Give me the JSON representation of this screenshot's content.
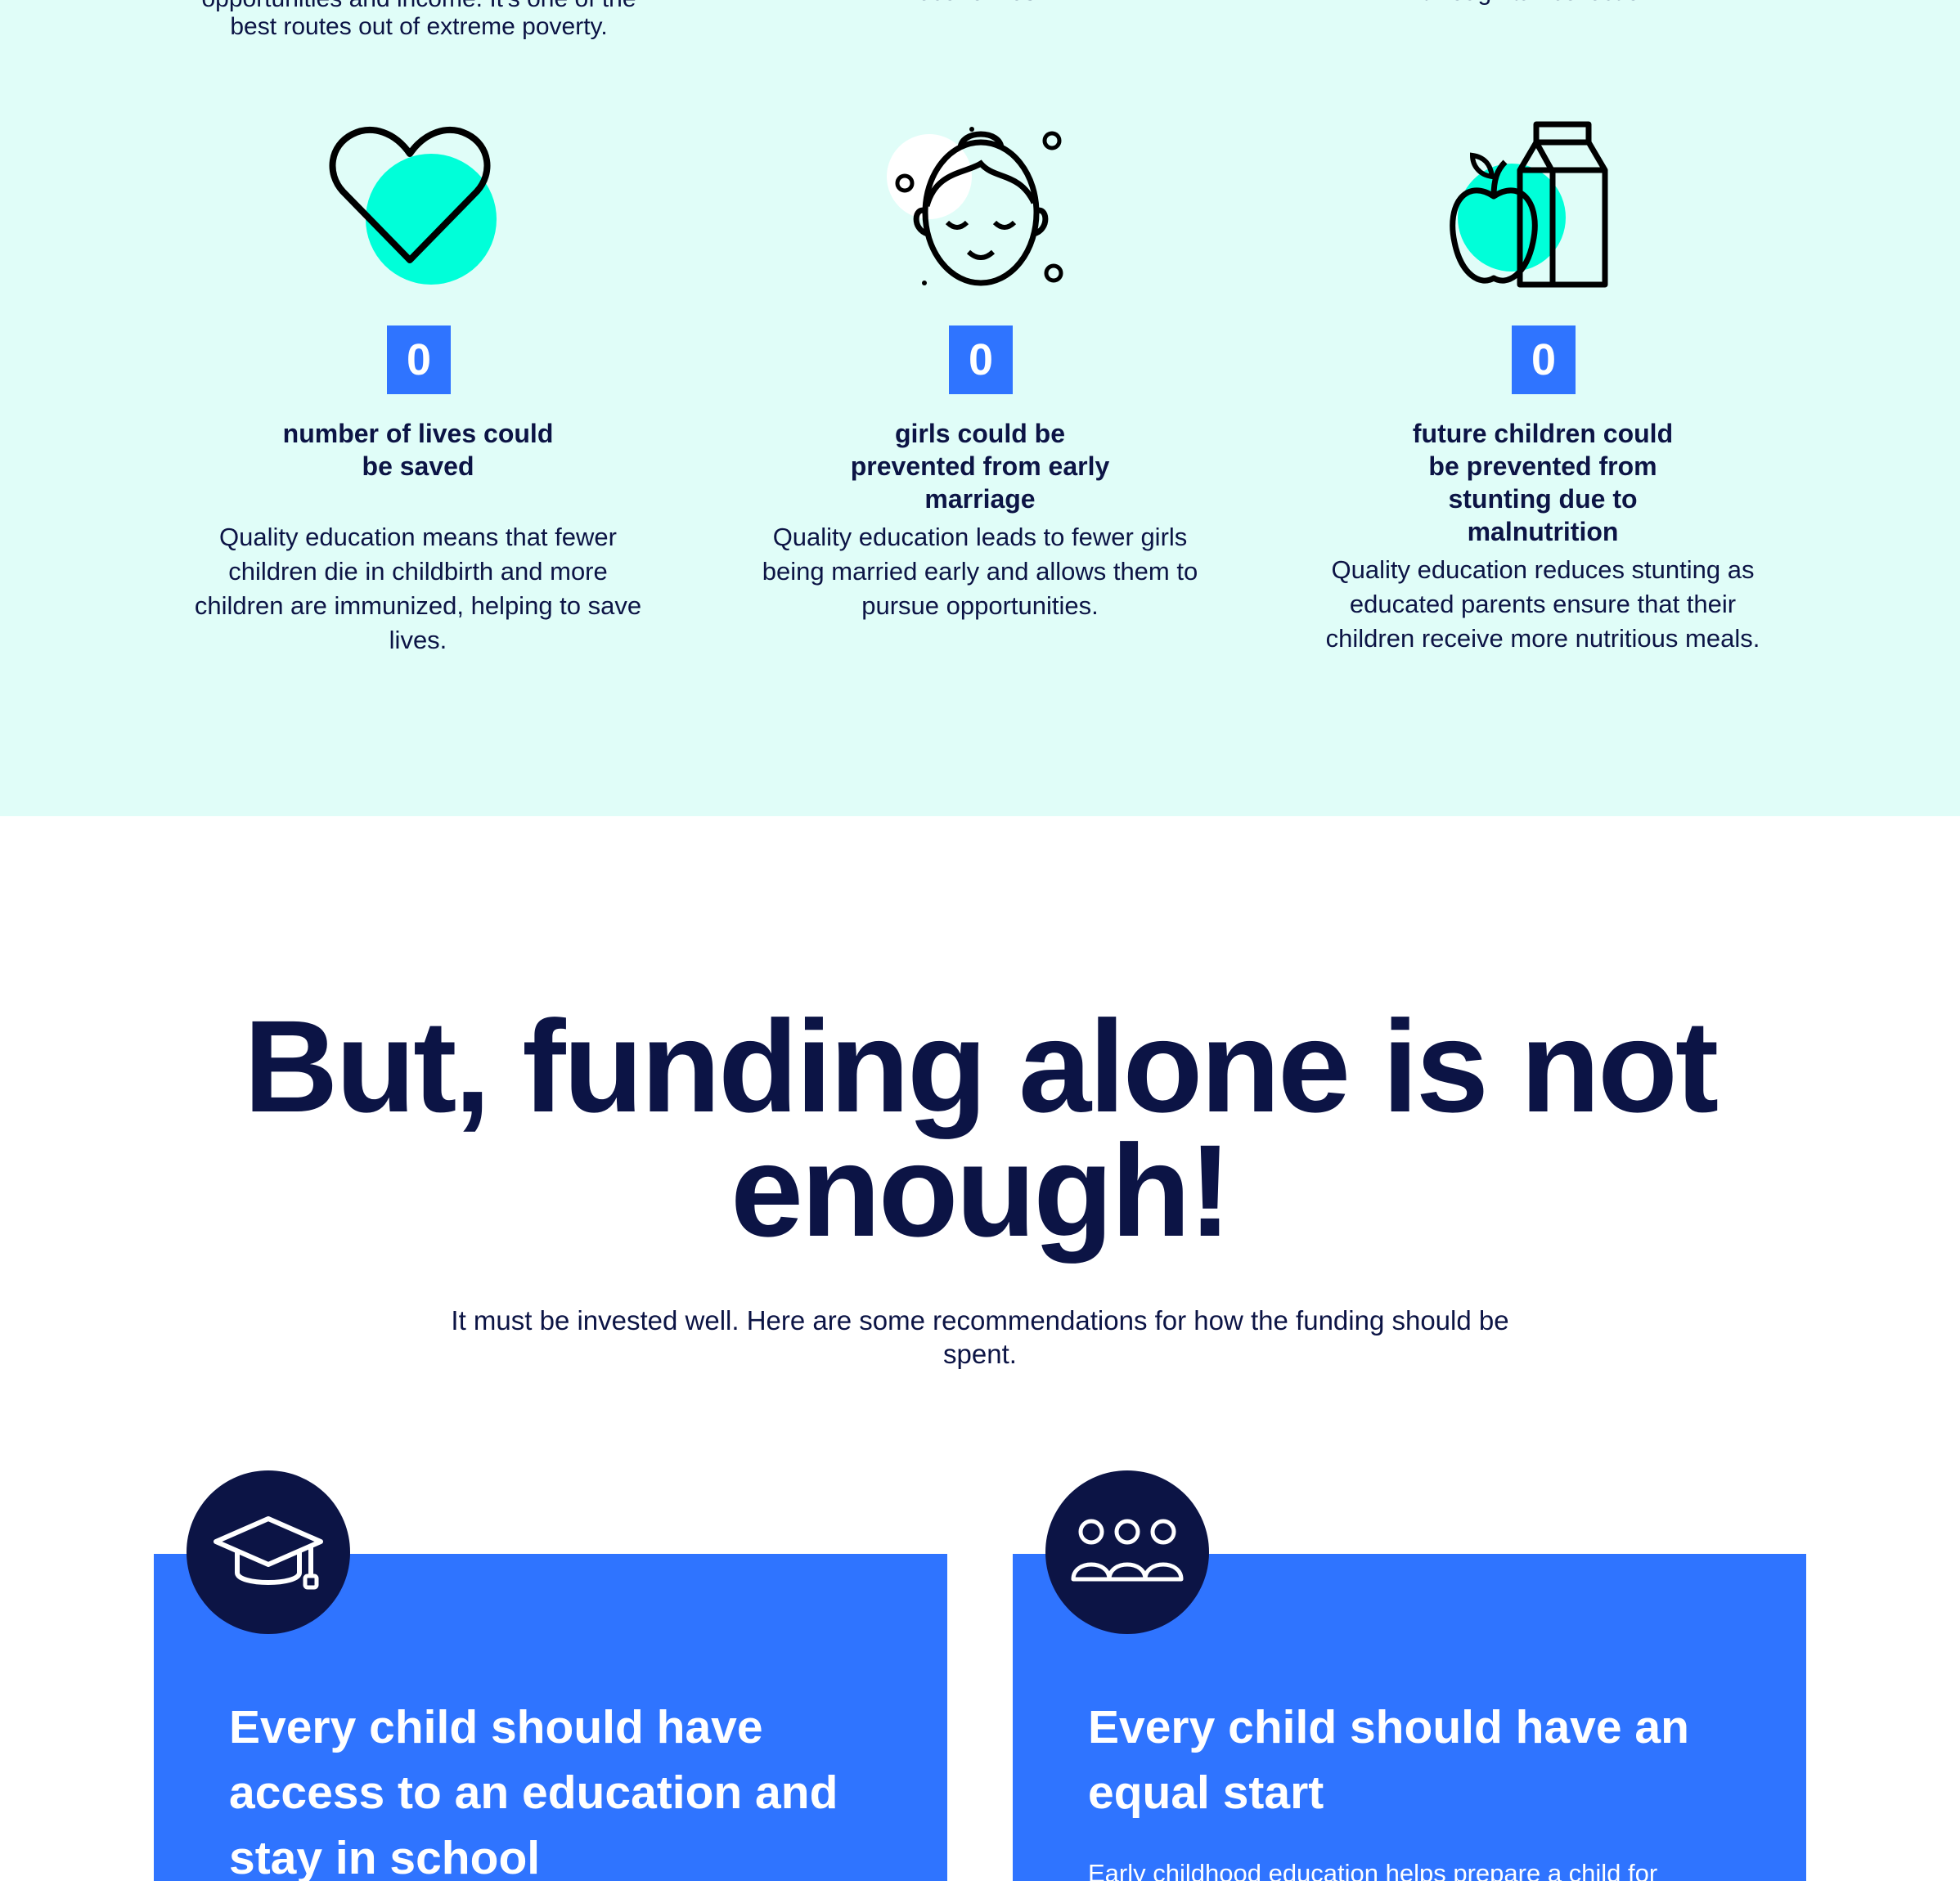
{
  "impact": {
    "top_texts": [
      "best routes out of extreme poverty.",
      "economies.",
      "through tax collection."
    ],
    "top_texts_line0": "opportunities and income. It's one of the",
    "stats": [
      {
        "icon": "heart-icon",
        "value": "0",
        "title": "number of lives could be saved",
        "body": "Quality education means that fewer children die in childbirth and more children are immunized, helping to save lives."
      },
      {
        "icon": "girl-face-icon",
        "value": "0",
        "title": "girls could be prevented from early marriage",
        "body": "Quality education leads to fewer girls being married early and allows them to pursue opportunities."
      },
      {
        "icon": "apple-milk-icon",
        "value": "0",
        "title": "future children could be prevented from stunting due to malnutrition",
        "body": "Quality education reduces stunting as educated parents ensure that their children receive more nutritious meals."
      }
    ]
  },
  "headline": {
    "line1": "But, funding alone is not",
    "line2": "enough!"
  },
  "intro": "It must be invested well. Here are some recommendations for how the funding should be spent.",
  "cards": [
    {
      "icon": "graduation-cap-icon",
      "title": "Every child should have access to an education and stay in school",
      "text": ""
    },
    {
      "icon": "group-people-icon",
      "title": "Every child should have an equal start",
      "text": "Early childhood education helps prepare a child for"
    }
  ],
  "colors": {
    "mint_bg": "#e0fdf8",
    "accent_teal": "#00ffd9",
    "blue": "#2f74ff",
    "navy": "#0c1445"
  }
}
